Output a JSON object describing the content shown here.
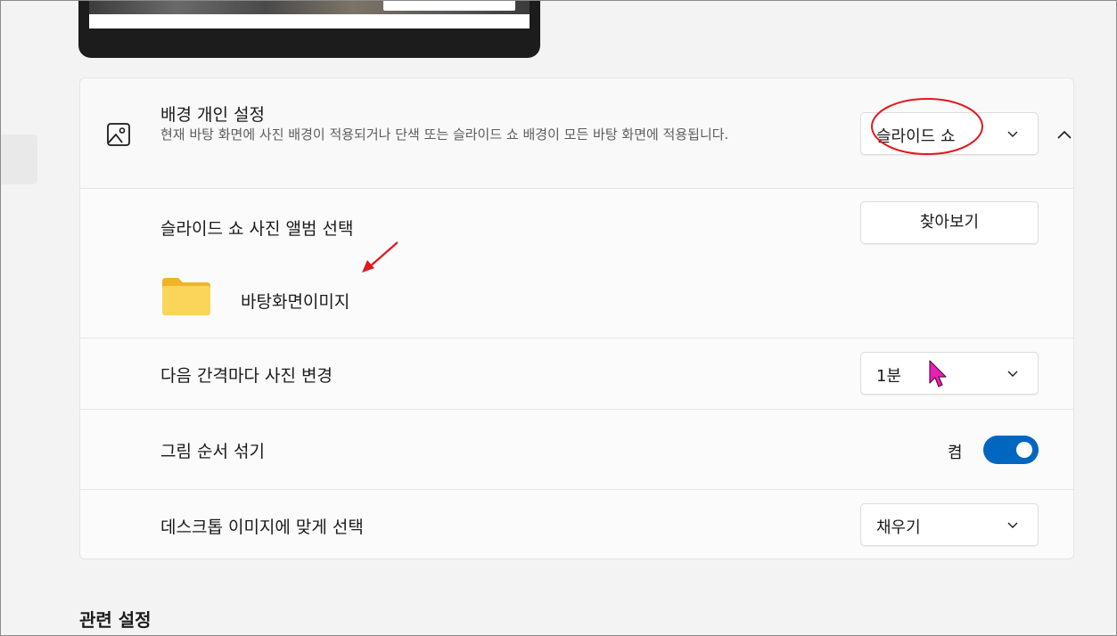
{
  "colors": {
    "accent": "#0067c0",
    "annotation": "#e0191f",
    "cursor": "#e620b4",
    "folder": "#f7c948"
  },
  "background_personalize": {
    "icon": "image-icon",
    "title": "배경 개인 설정",
    "description": "현재 바탕 화면에 사진 배경이 적용되거나 단색 또는 슬라이드 쇼 배경이 모든 바탕 화면에 적용됩니다.",
    "selected": "슬라이드 쇼",
    "expand_icon": "chevron-up-icon"
  },
  "album": {
    "title": "슬라이드 쇼 사진 앨범 선택",
    "browse_label": "찾아보기",
    "folder_icon": "folder-icon",
    "folder_name": "바탕화면이미지"
  },
  "interval": {
    "title": "다음 간격마다 사진 변경",
    "selected": "1분"
  },
  "shuffle": {
    "title": "그림 순서 섞기",
    "state_label": "켬",
    "on": true
  },
  "fit": {
    "title": "데스크톱 이미지에 맞게 선택",
    "selected": "채우기"
  },
  "related": {
    "heading": "관련 설정"
  }
}
